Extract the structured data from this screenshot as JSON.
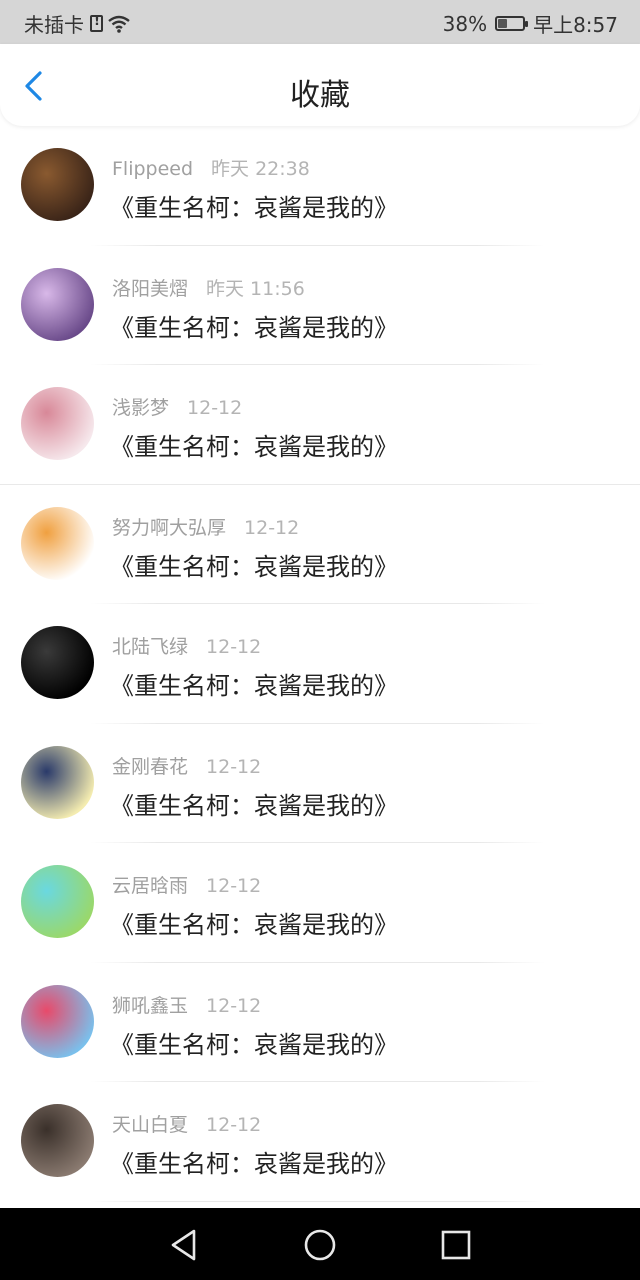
{
  "status_bar": {
    "carrier": "未插卡",
    "battery_percent": "38%",
    "battery_level": 0.38,
    "time": "早上8:57"
  },
  "header": {
    "title": "收藏"
  },
  "items": [
    {
      "name": "Flippeed",
      "time": "昨天 22:38",
      "text": "《重生名柯：哀酱是我的》",
      "avatar_colors": [
        "#3a2418",
        "#8a5a30"
      ]
    },
    {
      "name": "洛阳美熠",
      "time": "昨天 11:56",
      "text": "《重生名柯：哀酱是我的》",
      "avatar_colors": [
        "#6a4a8a",
        "#d8b8e8"
      ]
    },
    {
      "name": "浅影梦",
      "time": "12-12",
      "text": "《重生名柯：哀酱是我的》",
      "avatar_colors": [
        "#f6e8ec",
        "#d88898"
      ]
    },
    {
      "name": "努力啊大弘厚",
      "time": "12-12",
      "text": "《重生名柯：哀酱是我的》",
      "avatar_colors": [
        "#ffffff",
        "#f0a040"
      ]
    },
    {
      "name": "北陆飞绿",
      "time": "12-12",
      "text": "《重生名柯：哀酱是我的》",
      "avatar_colors": [
        "#000000",
        "#3a3a3a"
      ]
    },
    {
      "name": "金刚春花",
      "time": "12-12",
      "text": "《重生名柯：哀酱是我的》",
      "avatar_colors": [
        "#f4ecb0",
        "#2a3a6a"
      ]
    },
    {
      "name": "云居晗雨",
      "time": "12-12",
      "text": "《重生名柯：哀酱是我的》",
      "avatar_colors": [
        "#9ad86a",
        "#6ad8e0"
      ]
    },
    {
      "name": "狮吼鑫玉",
      "time": "12-12",
      "text": "《重生名柯：哀酱是我的》",
      "avatar_colors": [
        "#7ac0ec",
        "#e84a6a"
      ]
    },
    {
      "name": "天山白夏",
      "time": "12-12",
      "text": "《重生名柯：哀酱是我的》",
      "avatar_colors": [
        "#8a7a70",
        "#3a302a"
      ]
    }
  ],
  "colors": {
    "accent": "#1e88e5",
    "name_text": "#a0a0a0",
    "content_text": "#222222",
    "status_bar_bg": "#d6d6d6"
  },
  "icons": {
    "back": "chevron-left-icon",
    "sim": "sim-alert-icon",
    "wifi": "wifi-icon",
    "battery": "battery-icon",
    "nav_back": "triangle-back-icon",
    "nav_home": "circle-home-icon",
    "nav_recent": "square-recent-icon"
  }
}
